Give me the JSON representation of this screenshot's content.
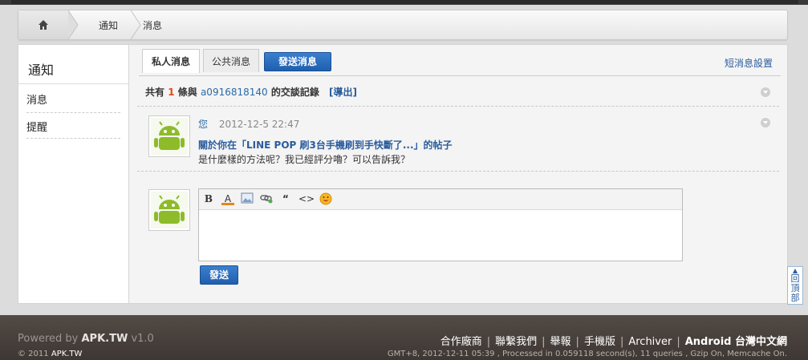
{
  "breadcrumb": {
    "home_icon": "home-icon",
    "items": [
      "通知",
      "消息"
    ]
  },
  "sidebar": {
    "title": "通知",
    "items": [
      {
        "label": "消息"
      },
      {
        "label": "提醒"
      }
    ]
  },
  "tabs": [
    {
      "label": "私人消息",
      "active": true
    },
    {
      "label": "公共消息",
      "active": false
    }
  ],
  "send_button": "發送消息",
  "settings_link": "短消息設置",
  "summary": {
    "prefix": "共有",
    "count": "1",
    "middle": "條與",
    "user": "a0916818140",
    "suffix": "的交談記錄",
    "export": "[導出]"
  },
  "message": {
    "author": "您",
    "time": "2012-12-5 22:47",
    "title": "關於你在「LINE POP 刷3台手機刷到手快斷了...」的帖子",
    "body": "是什麼樣的方法呢？我已經評分嚕？可以告訴我？"
  },
  "editor": {
    "toolbar": [
      {
        "name": "bold-icon",
        "glyph": "B"
      },
      {
        "name": "font-color-icon",
        "glyph": "A"
      },
      {
        "name": "image-icon",
        "glyph": ""
      },
      {
        "name": "link-icon",
        "glyph": ""
      },
      {
        "name": "quote-icon",
        "glyph": "“"
      },
      {
        "name": "code-icon",
        "glyph": "<>"
      },
      {
        "name": "smiley-icon",
        "glyph": ""
      }
    ]
  },
  "submit_button": "發送",
  "back_to_top": "回頂部",
  "footer": {
    "powered_prefix": "Powered by",
    "powered_brand": "APK.TW",
    "powered_version": "v1.0",
    "copyright_prefix": "© 2011",
    "copyright_brand": "APK.TW",
    "links": [
      "合作廠商",
      "聯繫我們",
      "舉報",
      "手機版",
      "Archiver",
      "Android 台灣中文網"
    ],
    "stats": "GMT+8, 2012-12-11 05:39 , Processed in 0.059118 second(s), 11 queries , Gzip On, Memcache On."
  },
  "colors": {
    "accent_blue": "#1f5fae",
    "link_blue": "#2a5c9c",
    "count_orange": "#e04a1c",
    "footer_bg": "#3e3733"
  }
}
